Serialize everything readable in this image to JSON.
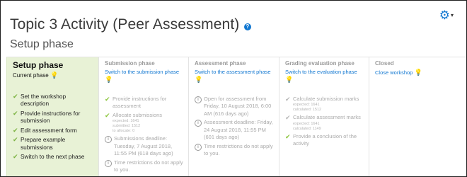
{
  "header": {
    "title": "Topic 3 Activity (Peer Assessment)",
    "help_icon": "?",
    "subtitle": "Setup phase",
    "settings_icon": "gear-icon"
  },
  "phases": [
    {
      "name": "Setup phase",
      "action": "Current phase",
      "tasks": [
        {
          "icon": "check",
          "text": "Set the workshop description"
        },
        {
          "icon": "check",
          "text": "Provide instructions for submission"
        },
        {
          "icon": "check",
          "text": "Edit assessment form"
        },
        {
          "icon": "check",
          "text": "Prepare example submissions"
        },
        {
          "icon": "check",
          "text": "Switch to the next phase"
        }
      ]
    },
    {
      "name": "Submission phase",
      "action": "Switch to the submission phase",
      "tasks": [
        {
          "icon": "check",
          "text": "Provide instructions for assessment"
        },
        {
          "icon": "check",
          "text": "Allocate submissions",
          "details": [
            "expected: 1641",
            "submitted: 1512",
            "to allocate: 0"
          ]
        },
        {
          "icon": "info",
          "text": "Submissions deadline: Tuesday, 7 August 2018, 11:55 PM (618 days ago)"
        },
        {
          "icon": "info",
          "text": "Time restrictions do not apply to you."
        }
      ]
    },
    {
      "name": "Assessment phase",
      "action": "Switch to the assessment phase",
      "tasks": [
        {
          "icon": "info",
          "text": "Open for assessment from Friday, 10 August 2018, 6:00 AM (616 days ago)"
        },
        {
          "icon": "info",
          "text": "Assessment deadline: Friday, 24 August 2018, 11:55 PM (601 days ago)"
        },
        {
          "icon": "info",
          "text": "Time restrictions do not apply to you."
        }
      ]
    },
    {
      "name": "Grading evaluation phase",
      "action": "Switch to the evaluation phase",
      "tasks": [
        {
          "icon": "dim-check",
          "text": "Calculate submission marks",
          "details": [
            "expected: 1641",
            "calculated: 1512"
          ]
        },
        {
          "icon": "dim-check",
          "text": "Calculate assessment marks",
          "details": [
            "expected: 1641",
            "calculated: 1149"
          ]
        },
        {
          "icon": "check",
          "text": "Provide a conclusion of the activity"
        }
      ]
    },
    {
      "name": "Closed",
      "action": "Close workshop",
      "tasks": []
    }
  ]
}
